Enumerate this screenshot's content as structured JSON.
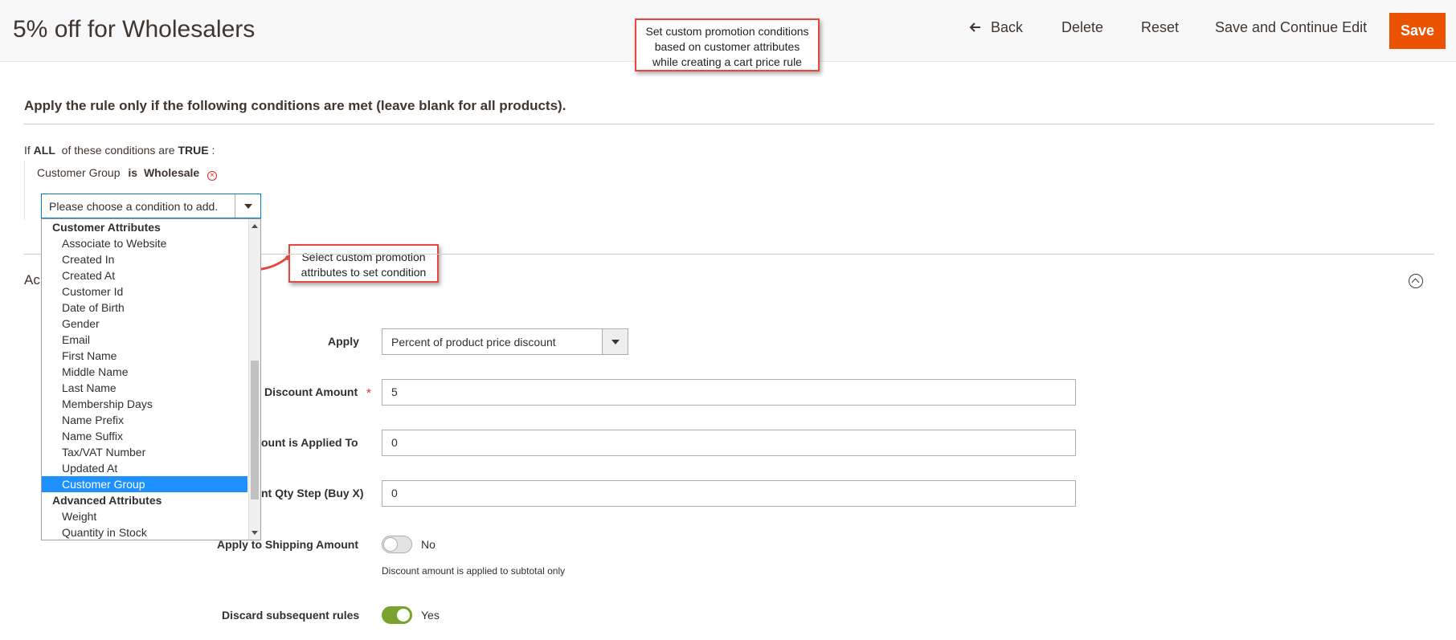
{
  "header": {
    "title": "5% off for Wholesalers",
    "back_label": "Back",
    "delete_label": "Delete",
    "reset_label": "Reset",
    "save_continue_label": "Save and Continue Edit",
    "save_label": "Save",
    "accent_color": "#eb5202"
  },
  "callouts": {
    "top": [
      "Set custom promotion conditions",
      "based on customer attributes",
      "while creating a cart price rule"
    ],
    "mid": [
      "Select custom promotion",
      "attributes to set condition"
    ]
  },
  "conditions": {
    "heading": "Apply the rule only if the following conditions are met (leave blank for all products).",
    "if_prefix": "If",
    "aggregator": "ALL",
    "of_these": "of these conditions are",
    "value": "TRUE",
    "colon": ":",
    "item": {
      "attribute": "Customer Group",
      "operator": "is",
      "value": "Wholesale"
    },
    "select_placeholder": "Please choose a condition to add."
  },
  "dropdown": [
    {
      "type": "group",
      "label": "Customer Attributes"
    },
    {
      "type": "option",
      "label": "Associate to Website"
    },
    {
      "type": "option",
      "label": "Created In"
    },
    {
      "type": "option",
      "label": "Created At"
    },
    {
      "type": "option",
      "label": "Customer Id"
    },
    {
      "type": "option",
      "label": "Date of Birth"
    },
    {
      "type": "option",
      "label": "Gender"
    },
    {
      "type": "option",
      "label": "Email"
    },
    {
      "type": "option",
      "label": "First Name"
    },
    {
      "type": "option",
      "label": "Middle Name"
    },
    {
      "type": "option",
      "label": "Last Name"
    },
    {
      "type": "option",
      "label": "Membership Days"
    },
    {
      "type": "option",
      "label": "Name Prefix"
    },
    {
      "type": "option",
      "label": "Name Suffix"
    },
    {
      "type": "option",
      "label": "Tax/VAT Number"
    },
    {
      "type": "option",
      "label": "Updated At"
    },
    {
      "type": "option",
      "label": "Customer Group",
      "selected": true
    },
    {
      "type": "group",
      "label": "Advanced Attributes"
    },
    {
      "type": "option",
      "label": "Weight"
    },
    {
      "type": "option",
      "label": "Quantity in Stock"
    }
  ],
  "actions": {
    "title_visible": "Ac",
    "apply_label": "Apply",
    "apply_value": "Percent of product price discount",
    "discount_amount_label_visible": "Discount Amount",
    "discount_amount": "5",
    "max_qty_label_visible": "ount is Applied To",
    "max_qty": "0",
    "qty_step_label_visible": "nt Qty Step (Buy X)",
    "qty_step": "0",
    "shipping_label_visible": "Apply to Shipping Amount",
    "shipping_state": "No",
    "shipping_note": "Discount amount is applied to subtotal only",
    "discard_label": "Discard subsequent rules",
    "discard_state": "Yes"
  }
}
